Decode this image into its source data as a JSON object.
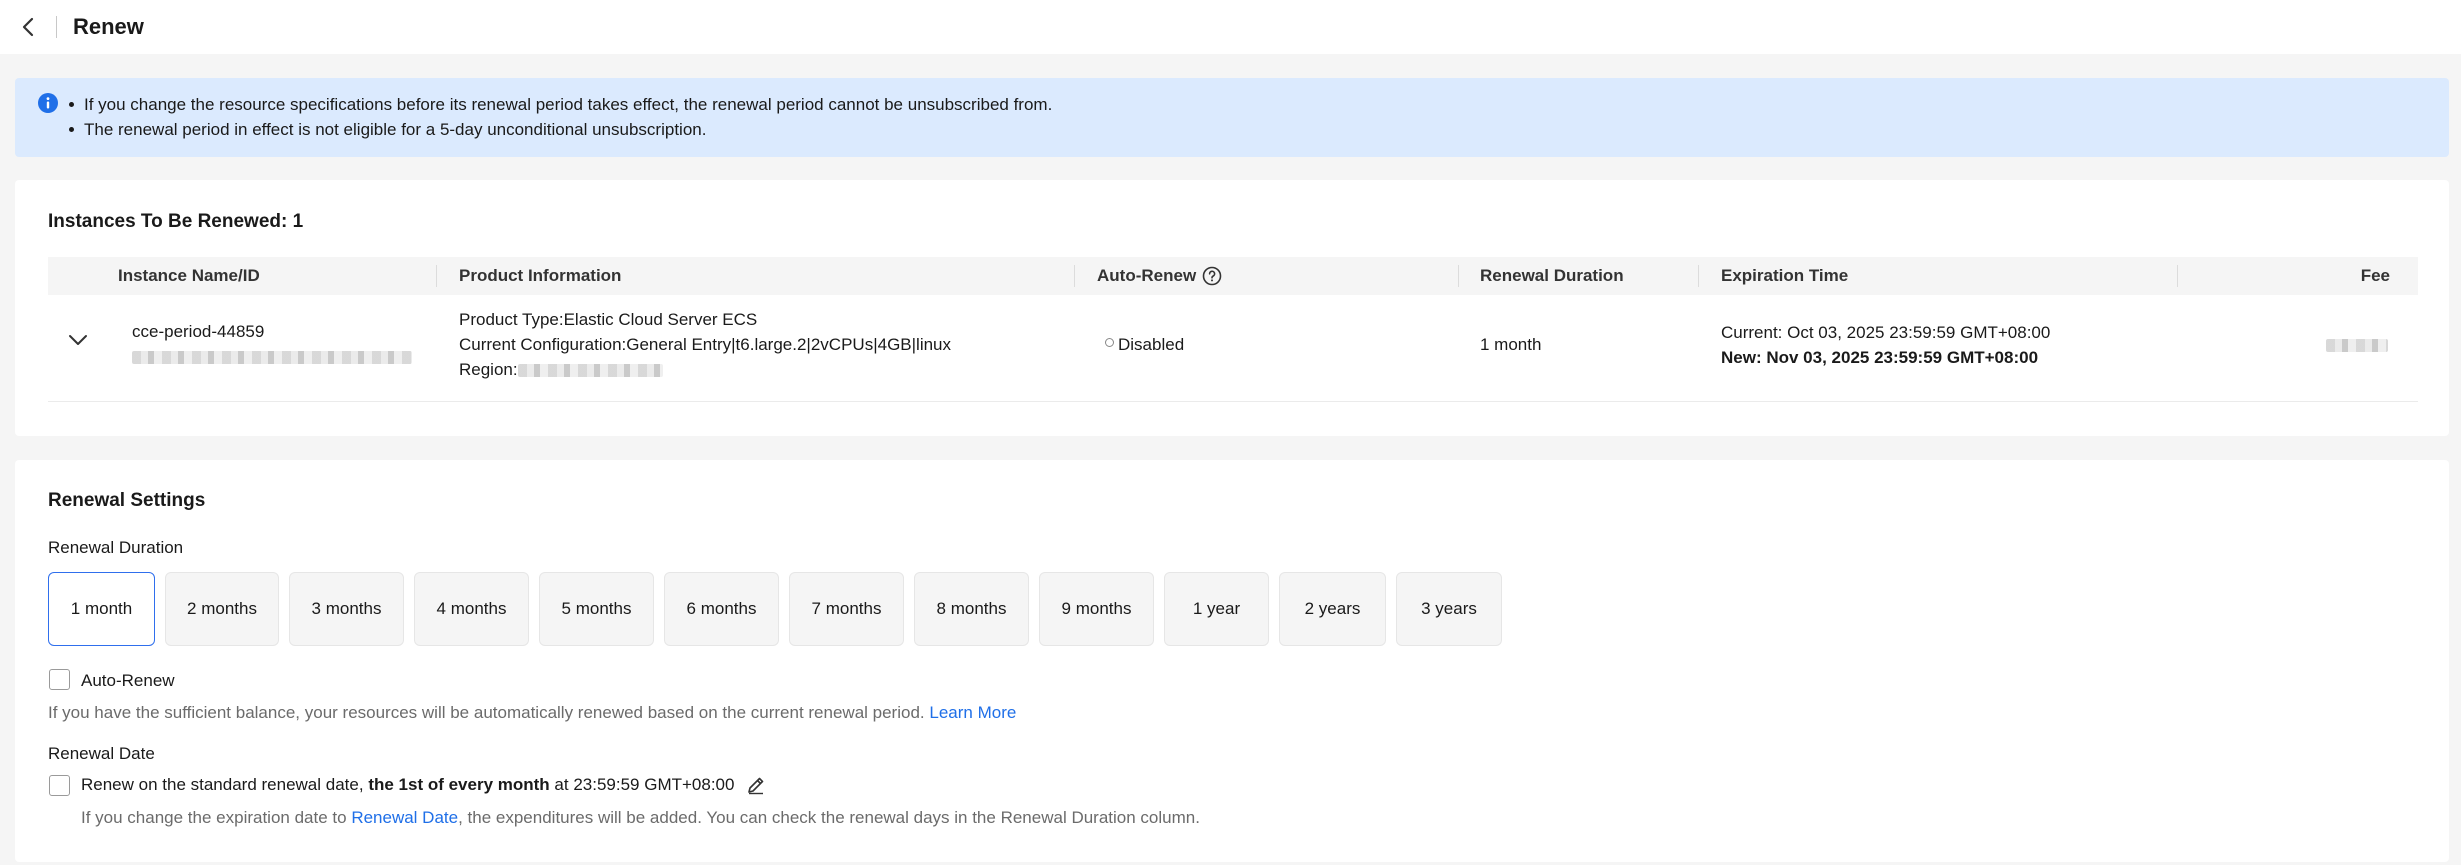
{
  "header": {
    "title": "Renew"
  },
  "notice": {
    "items": [
      "If you change the resource specifications before its renewal period takes effect, the renewal period cannot be unsubscribed from.",
      "The renewal period in effect is not eligible for a 5-day unconditional unsubscription."
    ]
  },
  "instances": {
    "title": "Instances To Be Renewed: 1",
    "columns": {
      "name": "Instance Name/ID",
      "product": "Product Information",
      "auto_renew": "Auto-Renew",
      "duration": "Renewal Duration",
      "expiration": "Expiration Time",
      "fee": "Fee"
    },
    "rows": [
      {
        "name": "cce-period-44859",
        "product_type": "Product Type:Elastic Cloud Server ECS",
        "configuration": "Current Configuration:General Entry|t6.large.2|2vCPUs|4GB|linux",
        "region_label": "Region:",
        "auto_renew": "Disabled",
        "duration": "1 month",
        "current_expiration": "Current: Oct 03, 2025 23:59:59 GMT+08:00",
        "new_expiration": "New: Nov 03, 2025 23:59:59 GMT+08:00"
      }
    ]
  },
  "settings": {
    "title": "Renewal Settings",
    "duration_label": "Renewal Duration",
    "durations": [
      "1 month",
      "2 months",
      "3 months",
      "4 months",
      "5 months",
      "6 months",
      "7 months",
      "8 months",
      "9 months",
      "1 year",
      "2 years",
      "3 years"
    ],
    "selected_duration": "1 month",
    "auto_renew_label": "Auto-Renew",
    "auto_renew_desc": "If you have the sufficient balance, your resources will be automatically renewed based on the current renewal period.",
    "learn_more": "Learn More",
    "renewal_date_label": "Renewal Date",
    "renewal_date_prefix": "Renew on the standard renewal date,",
    "renewal_date_bold": "the 1st of every month",
    "renewal_date_suffix": "at 23:59:59 GMT+08:00",
    "renewal_note_prefix": "If you change the expiration date to",
    "renewal_note_link": "Renewal Date",
    "renewal_note_suffix": ", the expenditures will be added. You can check the renewal days in the Renewal Duration column."
  },
  "colors": {
    "accent": "#2f6fed",
    "link": "#1f6fe8",
    "notice_bg": "#dbeafe"
  }
}
